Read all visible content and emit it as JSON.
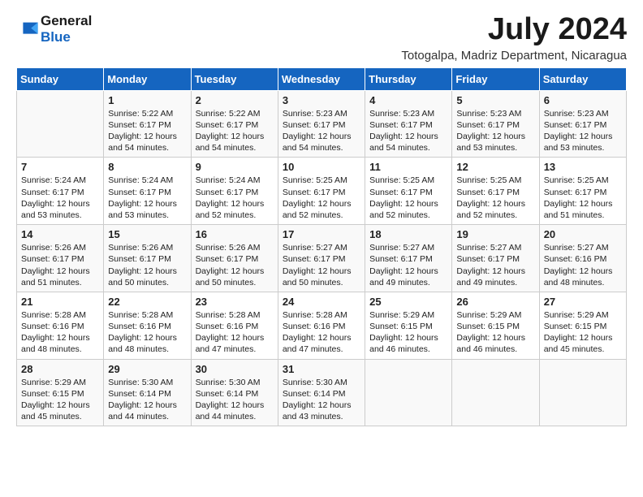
{
  "logo": {
    "line1": "General",
    "line2": "Blue"
  },
  "title": "July 2024",
  "subtitle": "Totogalpa, Madriz Department, Nicaragua",
  "days_header": [
    "Sunday",
    "Monday",
    "Tuesday",
    "Wednesday",
    "Thursday",
    "Friday",
    "Saturday"
  ],
  "weeks": [
    [
      {
        "day": "",
        "sunrise": "",
        "sunset": "",
        "daylight": ""
      },
      {
        "day": "1",
        "sunrise": "Sunrise: 5:22 AM",
        "sunset": "Sunset: 6:17 PM",
        "daylight": "Daylight: 12 hours and 54 minutes."
      },
      {
        "day": "2",
        "sunrise": "Sunrise: 5:22 AM",
        "sunset": "Sunset: 6:17 PM",
        "daylight": "Daylight: 12 hours and 54 minutes."
      },
      {
        "day": "3",
        "sunrise": "Sunrise: 5:23 AM",
        "sunset": "Sunset: 6:17 PM",
        "daylight": "Daylight: 12 hours and 54 minutes."
      },
      {
        "day": "4",
        "sunrise": "Sunrise: 5:23 AM",
        "sunset": "Sunset: 6:17 PM",
        "daylight": "Daylight: 12 hours and 54 minutes."
      },
      {
        "day": "5",
        "sunrise": "Sunrise: 5:23 AM",
        "sunset": "Sunset: 6:17 PM",
        "daylight": "Daylight: 12 hours and 53 minutes."
      },
      {
        "day": "6",
        "sunrise": "Sunrise: 5:23 AM",
        "sunset": "Sunset: 6:17 PM",
        "daylight": "Daylight: 12 hours and 53 minutes."
      }
    ],
    [
      {
        "day": "7",
        "sunrise": "Sunrise: 5:24 AM",
        "sunset": "Sunset: 6:17 PM",
        "daylight": "Daylight: 12 hours and 53 minutes."
      },
      {
        "day": "8",
        "sunrise": "Sunrise: 5:24 AM",
        "sunset": "Sunset: 6:17 PM",
        "daylight": "Daylight: 12 hours and 53 minutes."
      },
      {
        "day": "9",
        "sunrise": "Sunrise: 5:24 AM",
        "sunset": "Sunset: 6:17 PM",
        "daylight": "Daylight: 12 hours and 52 minutes."
      },
      {
        "day": "10",
        "sunrise": "Sunrise: 5:25 AM",
        "sunset": "Sunset: 6:17 PM",
        "daylight": "Daylight: 12 hours and 52 minutes."
      },
      {
        "day": "11",
        "sunrise": "Sunrise: 5:25 AM",
        "sunset": "Sunset: 6:17 PM",
        "daylight": "Daylight: 12 hours and 52 minutes."
      },
      {
        "day": "12",
        "sunrise": "Sunrise: 5:25 AM",
        "sunset": "Sunset: 6:17 PM",
        "daylight": "Daylight: 12 hours and 52 minutes."
      },
      {
        "day": "13",
        "sunrise": "Sunrise: 5:25 AM",
        "sunset": "Sunset: 6:17 PM",
        "daylight": "Daylight: 12 hours and 51 minutes."
      }
    ],
    [
      {
        "day": "14",
        "sunrise": "Sunrise: 5:26 AM",
        "sunset": "Sunset: 6:17 PM",
        "daylight": "Daylight: 12 hours and 51 minutes."
      },
      {
        "day": "15",
        "sunrise": "Sunrise: 5:26 AM",
        "sunset": "Sunset: 6:17 PM",
        "daylight": "Daylight: 12 hours and 50 minutes."
      },
      {
        "day": "16",
        "sunrise": "Sunrise: 5:26 AM",
        "sunset": "Sunset: 6:17 PM",
        "daylight": "Daylight: 12 hours and 50 minutes."
      },
      {
        "day": "17",
        "sunrise": "Sunrise: 5:27 AM",
        "sunset": "Sunset: 6:17 PM",
        "daylight": "Daylight: 12 hours and 50 minutes."
      },
      {
        "day": "18",
        "sunrise": "Sunrise: 5:27 AM",
        "sunset": "Sunset: 6:17 PM",
        "daylight": "Daylight: 12 hours and 49 minutes."
      },
      {
        "day": "19",
        "sunrise": "Sunrise: 5:27 AM",
        "sunset": "Sunset: 6:17 PM",
        "daylight": "Daylight: 12 hours and 49 minutes."
      },
      {
        "day": "20",
        "sunrise": "Sunrise: 5:27 AM",
        "sunset": "Sunset: 6:16 PM",
        "daylight": "Daylight: 12 hours and 48 minutes."
      }
    ],
    [
      {
        "day": "21",
        "sunrise": "Sunrise: 5:28 AM",
        "sunset": "Sunset: 6:16 PM",
        "daylight": "Daylight: 12 hours and 48 minutes."
      },
      {
        "day": "22",
        "sunrise": "Sunrise: 5:28 AM",
        "sunset": "Sunset: 6:16 PM",
        "daylight": "Daylight: 12 hours and 48 minutes."
      },
      {
        "day": "23",
        "sunrise": "Sunrise: 5:28 AM",
        "sunset": "Sunset: 6:16 PM",
        "daylight": "Daylight: 12 hours and 47 minutes."
      },
      {
        "day": "24",
        "sunrise": "Sunrise: 5:28 AM",
        "sunset": "Sunset: 6:16 PM",
        "daylight": "Daylight: 12 hours and 47 minutes."
      },
      {
        "day": "25",
        "sunrise": "Sunrise: 5:29 AM",
        "sunset": "Sunset: 6:15 PM",
        "daylight": "Daylight: 12 hours and 46 minutes."
      },
      {
        "day": "26",
        "sunrise": "Sunrise: 5:29 AM",
        "sunset": "Sunset: 6:15 PM",
        "daylight": "Daylight: 12 hours and 46 minutes."
      },
      {
        "day": "27",
        "sunrise": "Sunrise: 5:29 AM",
        "sunset": "Sunset: 6:15 PM",
        "daylight": "Daylight: 12 hours and 45 minutes."
      }
    ],
    [
      {
        "day": "28",
        "sunrise": "Sunrise: 5:29 AM",
        "sunset": "Sunset: 6:15 PM",
        "daylight": "Daylight: 12 hours and 45 minutes."
      },
      {
        "day": "29",
        "sunrise": "Sunrise: 5:30 AM",
        "sunset": "Sunset: 6:14 PM",
        "daylight": "Daylight: 12 hours and 44 minutes."
      },
      {
        "day": "30",
        "sunrise": "Sunrise: 5:30 AM",
        "sunset": "Sunset: 6:14 PM",
        "daylight": "Daylight: 12 hours and 44 minutes."
      },
      {
        "day": "31",
        "sunrise": "Sunrise: 5:30 AM",
        "sunset": "Sunset: 6:14 PM",
        "daylight": "Daylight: 12 hours and 43 minutes."
      },
      {
        "day": "",
        "sunrise": "",
        "sunset": "",
        "daylight": ""
      },
      {
        "day": "",
        "sunrise": "",
        "sunset": "",
        "daylight": ""
      },
      {
        "day": "",
        "sunrise": "",
        "sunset": "",
        "daylight": ""
      }
    ]
  ]
}
